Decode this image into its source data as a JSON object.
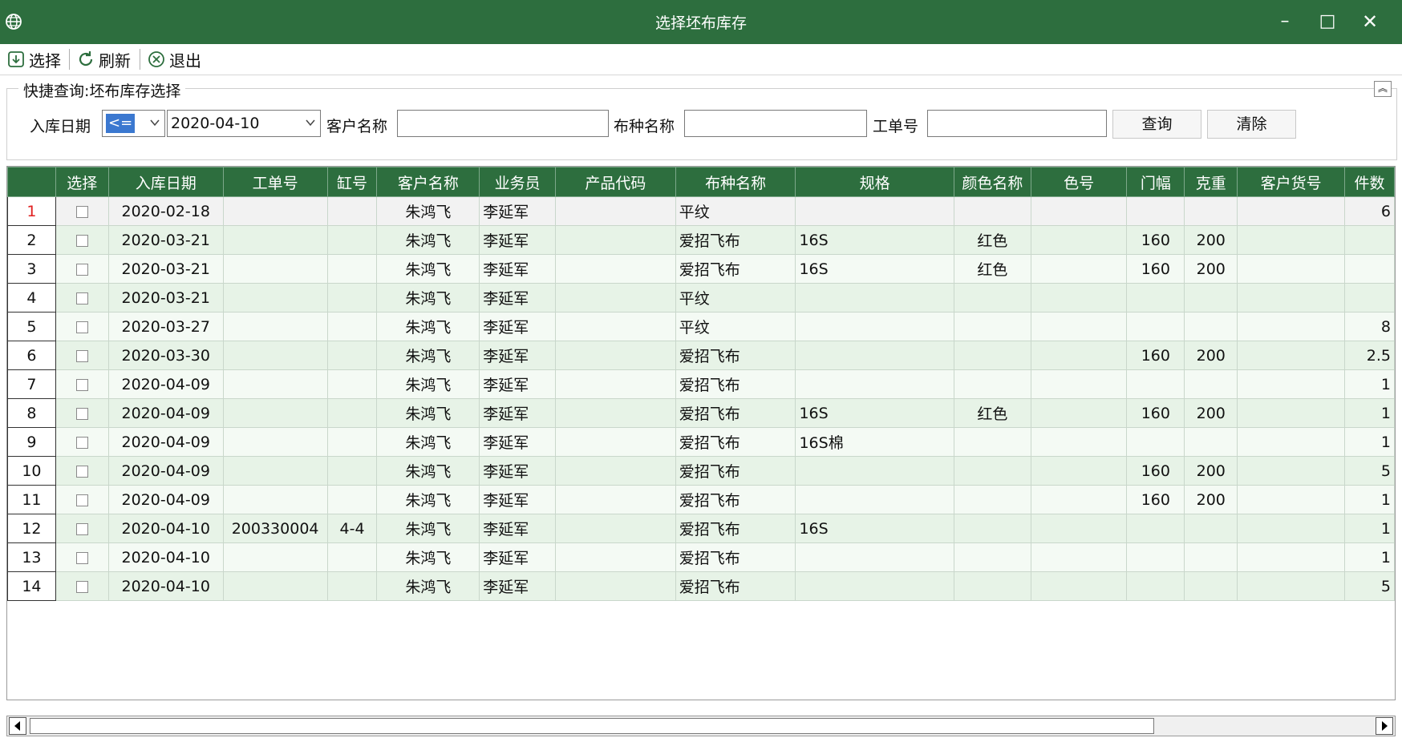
{
  "window": {
    "title": "选择坯布库存",
    "minimize": "–",
    "maximize": "□",
    "close": "✕"
  },
  "toolbar": {
    "select_label": "选择",
    "refresh_label": "刷新",
    "exit_label": "退出"
  },
  "query": {
    "legend": "快捷查询:坯布库存选择",
    "date_label": "入库日期",
    "date_operator": "<=",
    "date_value": "2020-04-10",
    "customer_label": "客户名称",
    "customer_value": "",
    "fabric_label": "布种名称",
    "fabric_value": "",
    "order_label": "工单号",
    "order_value": "",
    "search_button": "查询",
    "clear_button": "清除"
  },
  "grid": {
    "columns": [
      "",
      "选择",
      "入库日期",
      "工单号",
      "缸号",
      "客户名称",
      "业务员",
      "产品代码",
      "布种名称",
      "规格",
      "颜色名称",
      "色号",
      "门幅",
      "克重",
      "客户货号",
      "件数"
    ],
    "rows": [
      [
        "1",
        "",
        "2020-02-18",
        "",
        "",
        "朱鸿飞",
        "李延军",
        "",
        "平纹",
        "",
        "",
        "",
        "",
        "",
        "",
        "6"
      ],
      [
        "2",
        "",
        "2020-03-21",
        "",
        "",
        "朱鸿飞",
        "李延军",
        "",
        "爱招飞布",
        "16S",
        "红色",
        "",
        "160",
        "200",
        "",
        ""
      ],
      [
        "3",
        "",
        "2020-03-21",
        "",
        "",
        "朱鸿飞",
        "李延军",
        "",
        "爱招飞布",
        "16S",
        "红色",
        "",
        "160",
        "200",
        "",
        ""
      ],
      [
        "4",
        "",
        "2020-03-21",
        "",
        "",
        "朱鸿飞",
        "李延军",
        "",
        "平纹",
        "",
        "",
        "",
        "",
        "",
        "",
        ""
      ],
      [
        "5",
        "",
        "2020-03-27",
        "",
        "",
        "朱鸿飞",
        "李延军",
        "",
        "平纹",
        "",
        "",
        "",
        "",
        "",
        "",
        "8"
      ],
      [
        "6",
        "",
        "2020-03-30",
        "",
        "",
        "朱鸿飞",
        "李延军",
        "",
        "爱招飞布",
        "",
        "",
        "",
        "160",
        "200",
        "",
        "2.5"
      ],
      [
        "7",
        "",
        "2020-04-09",
        "",
        "",
        "朱鸿飞",
        "李延军",
        "",
        "爱招飞布",
        "",
        "",
        "",
        "",
        "",
        "",
        "1"
      ],
      [
        "8",
        "",
        "2020-04-09",
        "",
        "",
        "朱鸿飞",
        "李延军",
        "",
        "爱招飞布",
        "16S",
        "红色",
        "",
        "160",
        "200",
        "",
        "1"
      ],
      [
        "9",
        "",
        "2020-04-09",
        "",
        "",
        "朱鸿飞",
        "李延军",
        "",
        "爱招飞布",
        "16S棉",
        "",
        "",
        "",
        "",
        "",
        "1"
      ],
      [
        "10",
        "",
        "2020-04-09",
        "",
        "",
        "朱鸿飞",
        "李延军",
        "",
        "爱招飞布",
        "",
        "",
        "",
        "160",
        "200",
        "",
        "5"
      ],
      [
        "11",
        "",
        "2020-04-09",
        "",
        "",
        "朱鸿飞",
        "李延军",
        "",
        "爱招飞布",
        "",
        "",
        "",
        "160",
        "200",
        "",
        "1"
      ],
      [
        "12",
        "",
        "2020-04-10",
        "200330004",
        "4-4",
        "朱鸿飞",
        "李延军",
        "",
        "爱招飞布",
        "16S",
        "",
        "",
        "",
        "",
        "",
        "1"
      ],
      [
        "13",
        "",
        "2020-04-10",
        "",
        "",
        "朱鸿飞",
        "李延军",
        "",
        "爱招飞布",
        "",
        "",
        "",
        "",
        "",
        "",
        "1"
      ],
      [
        "14",
        "",
        "2020-04-10",
        "",
        "",
        "朱鸿飞",
        "李延军",
        "",
        "爱招飞布",
        "",
        "",
        "",
        "",
        "",
        "",
        "5"
      ]
    ]
  },
  "colors": {
    "title_bar": "#2d6e3e",
    "header_bg": "#2d6e3e",
    "row_even": "#e7f3e7",
    "row_odd": "#f4faf4",
    "selected_row_number": "#e02020"
  }
}
